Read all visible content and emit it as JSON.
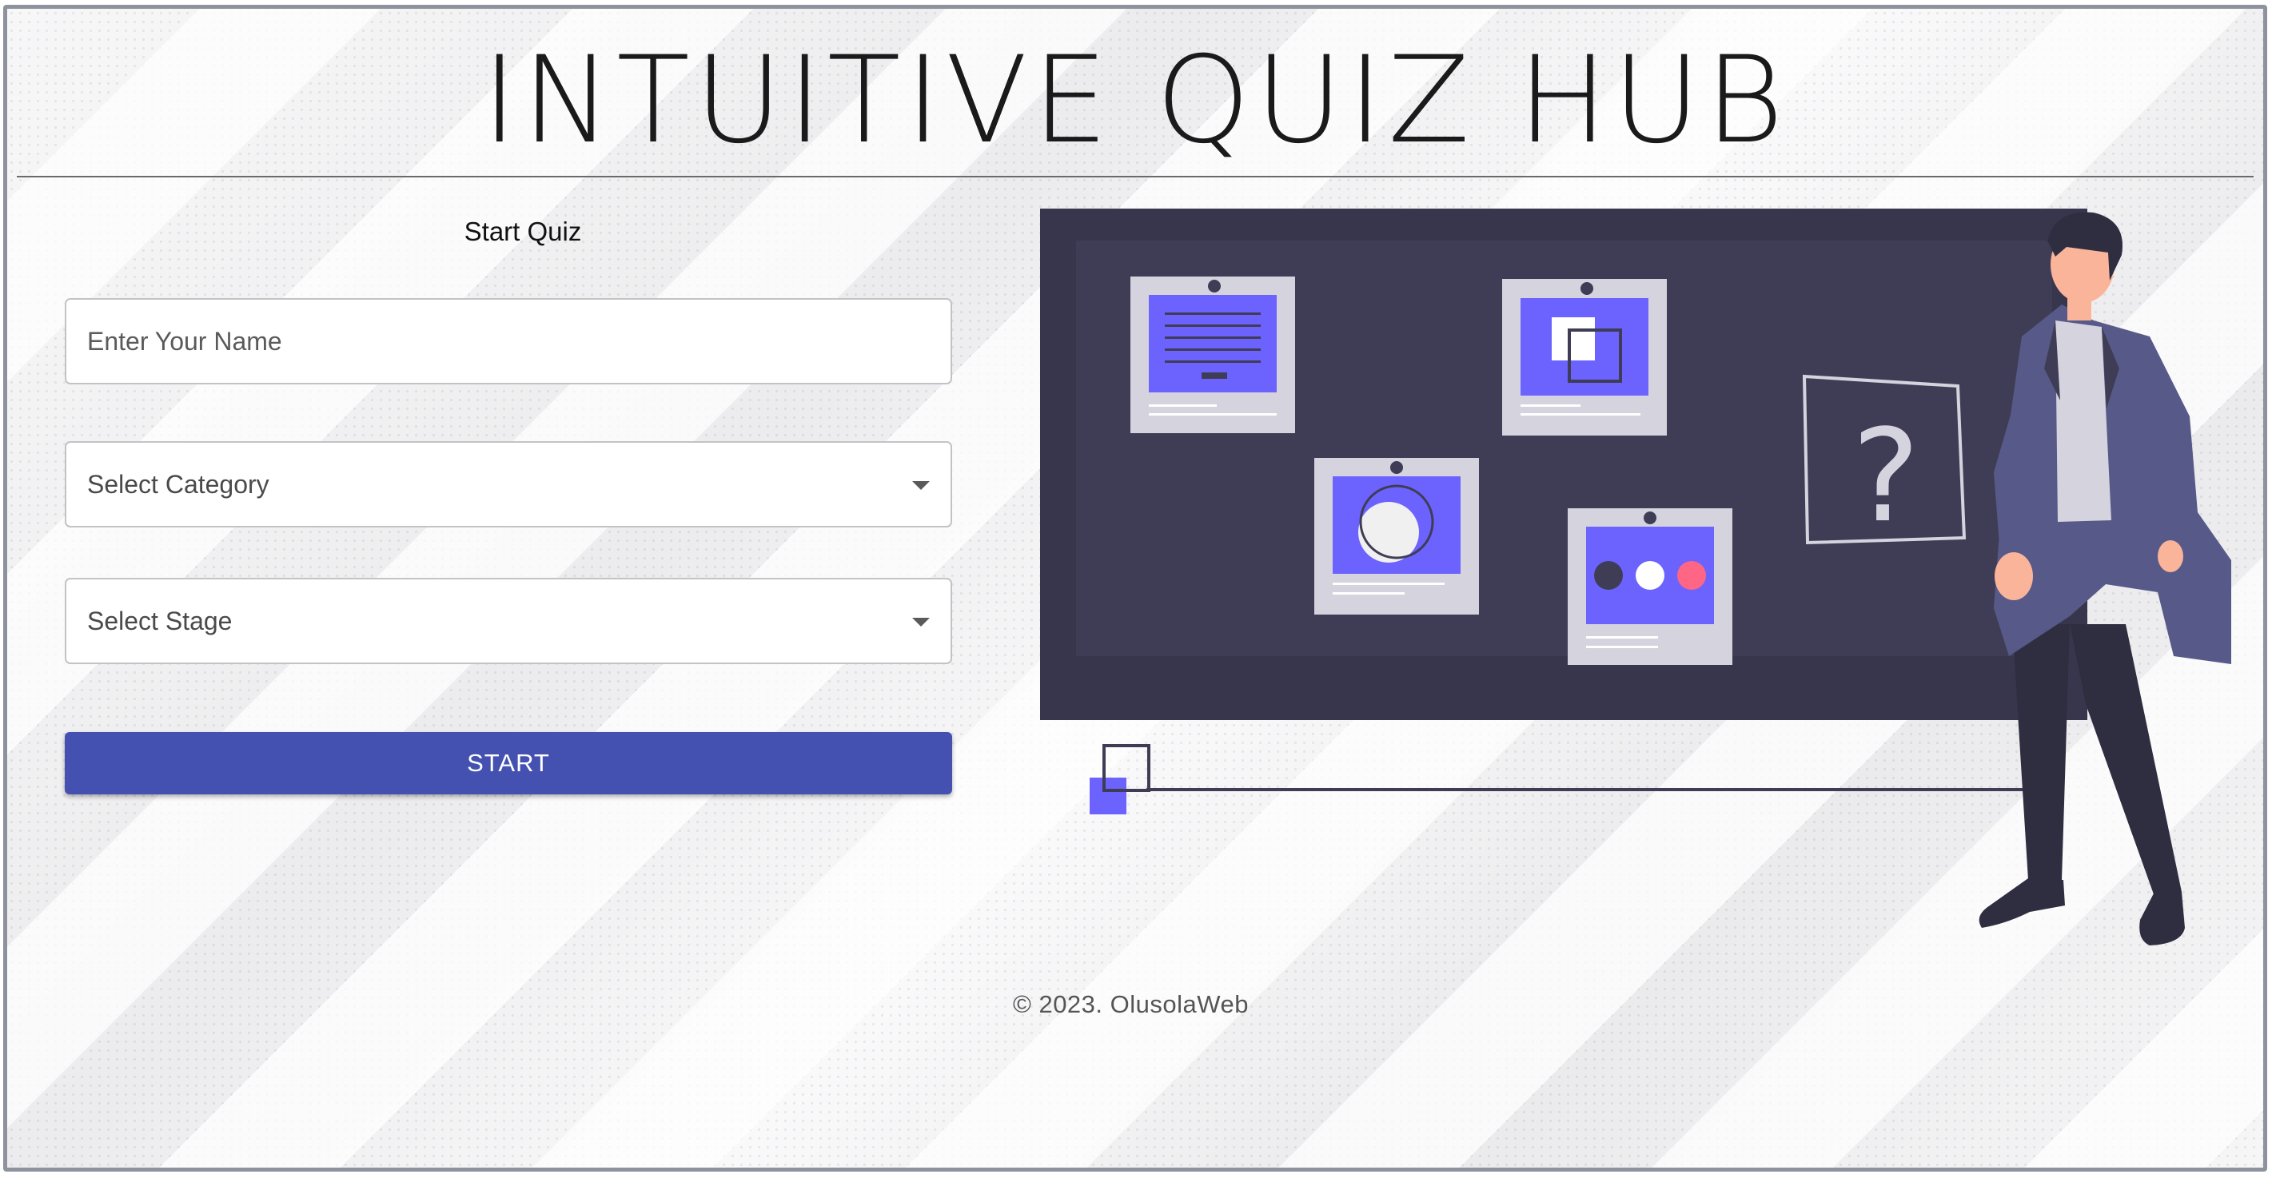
{
  "header": {
    "title": "INTUITIVE QUIZ HUB"
  },
  "form": {
    "heading": "Start Quiz",
    "name_placeholder": "Enter Your Name",
    "category_label": "Select Category",
    "stage_label": "Select Stage",
    "start_label": "START"
  },
  "illustration": {
    "question_mark": "?",
    "icons": [
      "text-card-icon",
      "square-card-icon",
      "circle-card-icon",
      "dots-card-icon",
      "question-board-icon",
      "presenter-person-illustration"
    ]
  },
  "colors": {
    "accent": "#4451b0",
    "board": "#3f3d55",
    "card_accent": "#6c63ff",
    "dot_red": "#ff6584"
  },
  "footer": {
    "copyright": "© 2023.  OlusolaWeb"
  }
}
